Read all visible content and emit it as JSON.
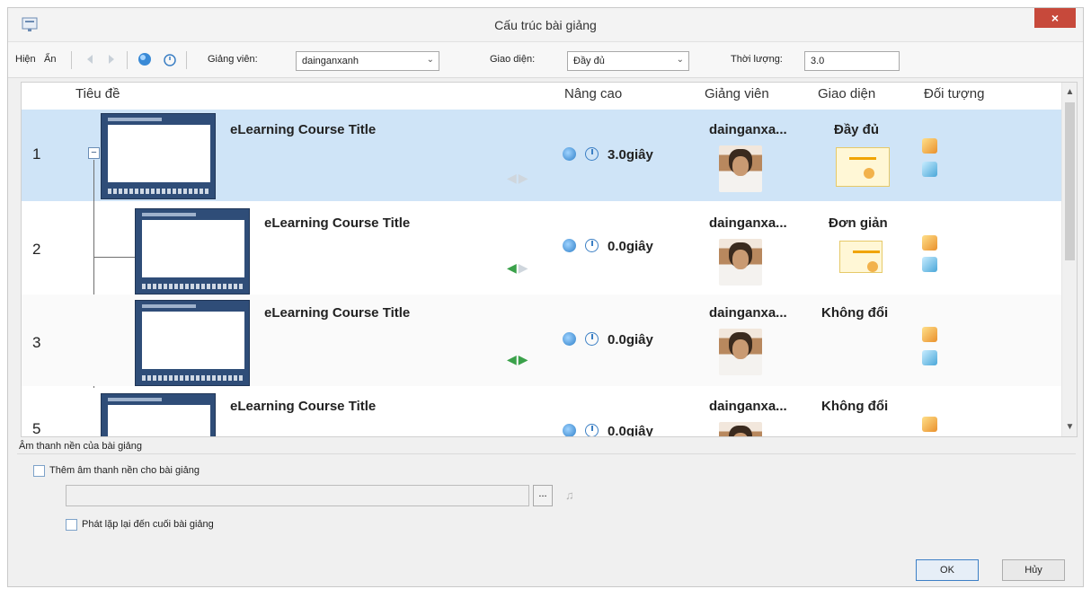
{
  "window": {
    "title": "Cấu trúc bài giảng",
    "close_glyph": "×"
  },
  "toolbar": {
    "show_label": "Hiện",
    "hide_label": "Ẩn",
    "instructor_label": "Giảng viên:",
    "instructor_value": "dainganxanh",
    "layout_label": "Giao diện:",
    "layout_value": "Đầy đủ",
    "duration_label": "Thời lượng:",
    "duration_value": "3.0"
  },
  "list": {
    "headers": {
      "title": "Tiêu đề",
      "advanced": "Nâng cao",
      "instructor": "Giảng viên",
      "layout": "Giao diện",
      "objects": "Đối tượng"
    },
    "rows": [
      {
        "num": "1",
        "title": "eLearning Course Title",
        "duration": "3.0giây",
        "instructor": "dainganxa...",
        "layout": "Đầy đủ",
        "selected": true
      },
      {
        "num": "2",
        "title": "eLearning Course Title",
        "duration": "0.0giây",
        "instructor": "dainganxa...",
        "layout": "Đơn giản",
        "selected": false
      },
      {
        "num": "3",
        "title": "eLearning Course Title",
        "duration": "0.0giây",
        "instructor": "dainganxa...",
        "layout": "Không đổi",
        "selected": false
      },
      {
        "num": "5",
        "title": "eLearning Course Title",
        "duration": "0.0giây",
        "instructor": "dainganxa...",
        "layout": "Không đổi",
        "selected": false
      }
    ]
  },
  "audio": {
    "section_label": "Âm thanh nền của bài giảng",
    "add_label": "Thêm âm thanh nền cho bài giảng",
    "file_value": "",
    "browse_label": "...",
    "loop_label": "Phát lặp lại đến cuối bài giảng"
  },
  "buttons": {
    "ok": "OK",
    "cancel": "Hủy"
  },
  "colors": {
    "selection": "#cfe4f7",
    "close": "#c7493b",
    "accent": "#3c7fc6"
  }
}
